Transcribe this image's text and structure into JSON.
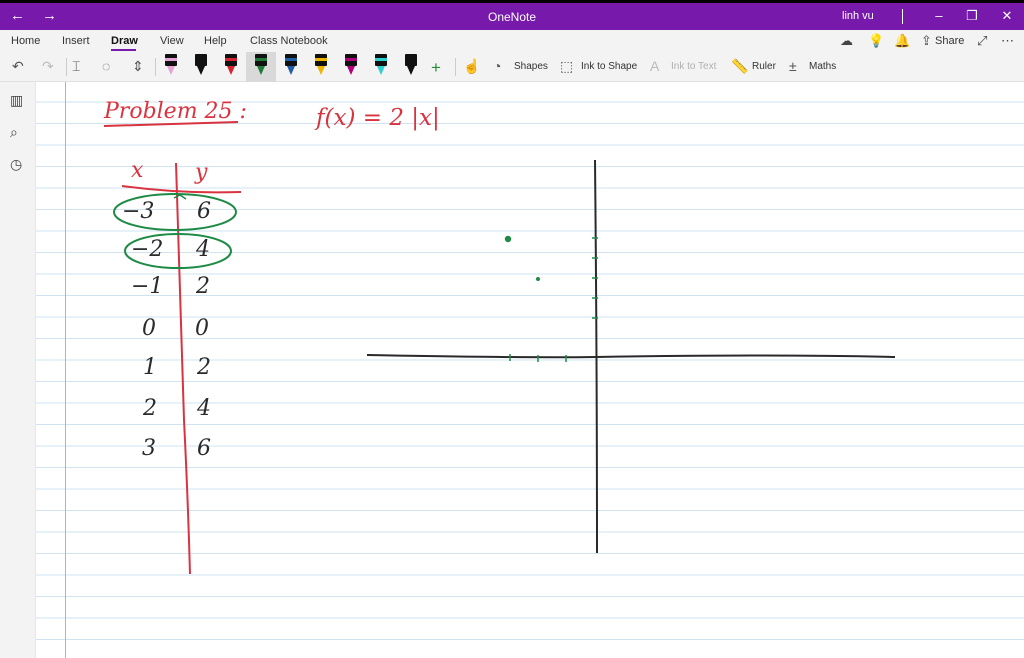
{
  "app": {
    "title": "OneNote",
    "user": "linh vu",
    "back_icon": "back-arrow-icon",
    "forward_icon": "forward-arrow-icon"
  },
  "menu": {
    "tabs": [
      "Home",
      "Insert",
      "Draw",
      "View",
      "Help",
      "Class Notebook"
    ],
    "active_tab": "Draw",
    "share_label": "Share"
  },
  "toolbar": {
    "shapes_label": "Shapes",
    "ink_to_shape_label": "Ink to Shape",
    "ink_to_text_label": "Ink to Text",
    "ruler_label": "Ruler",
    "maths_label": "Maths",
    "pen_colors": [
      "#e6a3d6",
      "#111111",
      "#d8222f",
      "#1f7a3a",
      "#1f5fa8",
      "#f0b400",
      "#b0007a",
      "#2ad1d1",
      "#111111"
    ]
  },
  "note": {
    "problem_title": "Problem 25 :",
    "function": "f(x) = 2 |x|",
    "table_header_x": "x",
    "table_header_y": "y",
    "table_rows": [
      {
        "x": "−3",
        "y": "6"
      },
      {
        "x": "−2",
        "y": "4"
      },
      {
        "x": "−1",
        "y": "2"
      },
      {
        "x": "0",
        "y": "0"
      },
      {
        "x": "1",
        "y": "2"
      },
      {
        "x": "2",
        "y": "4"
      },
      {
        "x": "3",
        "y": "6"
      }
    ],
    "ink_colors": {
      "red": "#d8333f",
      "green": "#1e8a46",
      "black": "#2a2a2a"
    }
  }
}
